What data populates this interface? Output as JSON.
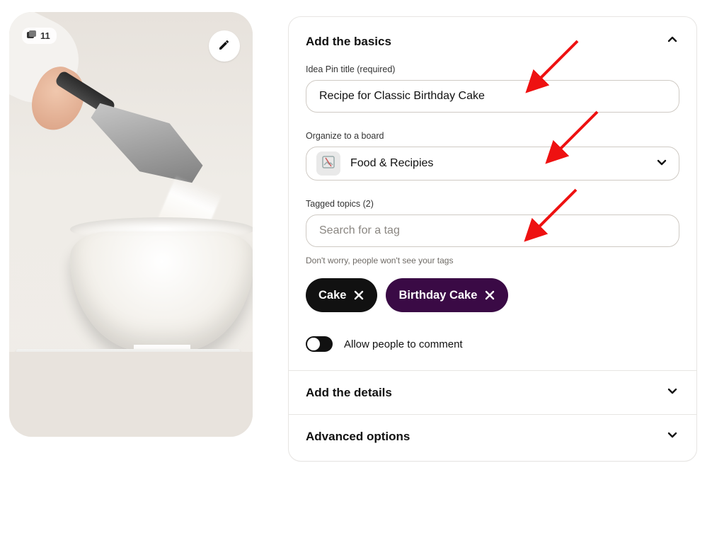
{
  "preview": {
    "page_count": "11"
  },
  "basics": {
    "title": "Add the basics",
    "title_label": "Idea Pin title (required)",
    "title_value": "Recipe for Classic Birthday Cake",
    "board_label": "Organize to a board",
    "board_name": "Food & Recipies",
    "tags_label": "Tagged topics (2)",
    "tags_placeholder": "Search for a tag",
    "tags_helper": "Don't worry, people won't see your tags",
    "tags": [
      "Cake",
      "Birthday Cake"
    ],
    "comments_label": "Allow people to comment"
  },
  "sections": {
    "details": "Add the details",
    "advanced": "Advanced options"
  }
}
